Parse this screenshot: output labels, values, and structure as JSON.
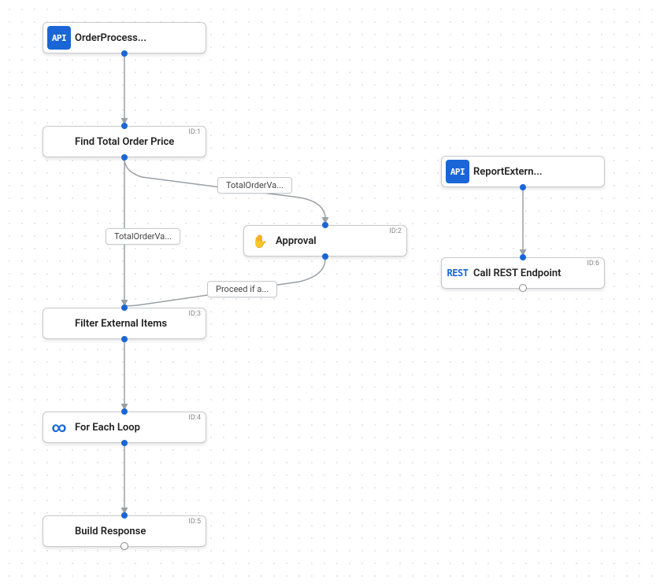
{
  "nodes": [
    {
      "label": "OrderProcess...",
      "iconText": "API",
      "type": "trigger"
    },
    {
      "label": "Find Total Order Price",
      "id": "ID:1",
      "type": "mapper"
    },
    {
      "label": "Approval",
      "id": "ID:2",
      "type": "approval"
    },
    {
      "label": "Filter External Items",
      "id": "ID:3",
      "type": "mapper"
    },
    {
      "label": "For Each Loop",
      "id": "ID:4",
      "type": "loop"
    },
    {
      "label": "Build Response",
      "id": "ID:5",
      "type": "mapper"
    },
    {
      "label": "ReportExtern...",
      "iconText": "API",
      "type": "trigger"
    },
    {
      "label": "Call REST Endpoint",
      "id": "ID:6",
      "iconText": "REST",
      "type": "rest"
    }
  ],
  "edgeLabels": [
    "TotalOrderVa...",
    "TotalOrderVa...",
    "Proceed if a..."
  ],
  "colors": {
    "accent": "#1a66d6",
    "connector": "#9aa0a6",
    "border": "#c7c9cc"
  }
}
